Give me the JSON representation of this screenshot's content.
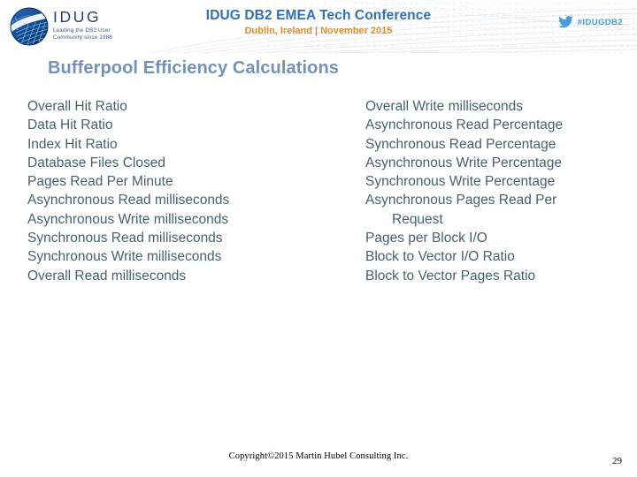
{
  "header": {
    "logo": {
      "icon": "idug-globe-icon",
      "wordmark": "IDUG",
      "tagline_line1": "Leading the DB2 User",
      "tagline_line2": "Community since 1988"
    },
    "conference": {
      "title": "IDUG DB2 EMEA Tech Conference",
      "location": "Dublin, Ireland",
      "separator": "|",
      "date": "November 2015"
    },
    "twitter": {
      "icon": "twitter-bird-icon",
      "handle": "#IDUGDB2"
    },
    "colors": {
      "conference_title": "#2f6fb5",
      "conference_date": "#e08b2a",
      "twitter": "#4a9bd8",
      "logo_wordmark": "#2a3f7a"
    }
  },
  "slide": {
    "title": "Bufferpool Efficiency Calculations",
    "title_color": "#7292b9",
    "body_color": "#46616e",
    "left_column": [
      "Overall Hit Ratio",
      "Data Hit Ratio",
      "Index Hit Ratio",
      "Database Files Closed",
      "Pages Read Per Minute",
      "Asynchronous Read milliseconds",
      "Asynchronous Write milliseconds",
      "Synchronous Read milliseconds",
      "Synchronous Write milliseconds",
      "Overall Read milliseconds"
    ],
    "right_column": [
      "Overall Write milliseconds",
      "Asynchronous Read Percentage",
      "Synchronous Read Percentage",
      "Asynchronous Write Percentage",
      "Synchronous Write Percentage",
      "Asynchronous Pages Read Per Request",
      "Pages per Block I/O",
      "Block to Vector I/O Ratio",
      "Block to Vector Pages Ratio"
    ],
    "right_column_wrapped": {
      "index": 5,
      "line1": "Asynchronous Pages Read Per",
      "line2": "Request"
    }
  },
  "footer": {
    "copyright": "Copyright©2015 Martin Hubel Consulting Inc.",
    "page_number": "29"
  }
}
